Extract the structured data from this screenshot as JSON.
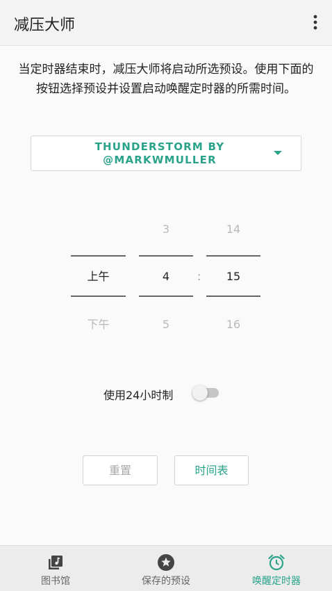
{
  "appbar": {
    "title": "减压大师",
    "more_icon": "more-vertical-icon"
  },
  "description": "当定时器结束时，减压大师将启动所选预设。使用下面的按钮选择预设并设置启动唤醒定时器的所需时间。",
  "preset_select": {
    "value": "THUNDERSTORM BY @MARKWMULLER",
    "icon": "dropdown-arrow-icon"
  },
  "time_picker": {
    "ampm": {
      "prev": "",
      "current": "上午",
      "next": "下午"
    },
    "hour": {
      "prev": "3",
      "current": "4",
      "next": "5"
    },
    "separator": ":",
    "minute": {
      "prev": "14",
      "current": "15",
      "next": "16"
    }
  },
  "format_toggle": {
    "label": "使用24小时制",
    "enabled": false
  },
  "buttons": {
    "reset": "重置",
    "schedule": "时间表"
  },
  "bottom_nav": [
    {
      "label": "图书馆",
      "icon": "library-icon",
      "active": false
    },
    {
      "label": "保存的预设",
      "icon": "star-icon",
      "active": false
    },
    {
      "label": "唤醒定时器",
      "icon": "alarm-clock-icon",
      "active": true
    }
  ],
  "colors": {
    "accent": "#2aa38a",
    "appbar": "#f3f3f3",
    "bottom_nav": "#ececec"
  }
}
